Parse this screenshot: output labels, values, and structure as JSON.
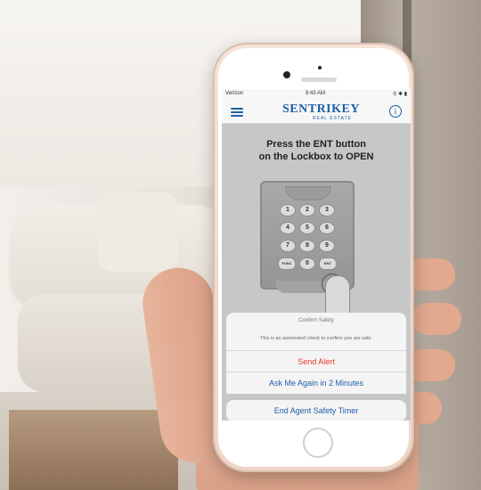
{
  "status": {
    "carrier": "Verizon",
    "time": "9:43 AM",
    "right": "⚲ ✱ ▮"
  },
  "header": {
    "brand": "SENTRIKEY",
    "brand_sub": "REAL ESTATE"
  },
  "instruction": "Press the ENT button\non the Lockbox to OPEN",
  "lockbox": {
    "keys": [
      "1",
      "2",
      "3",
      "4",
      "5",
      "6",
      "7",
      "8",
      "9",
      "FUNC",
      "0",
      "ENT"
    ]
  },
  "dialog": {
    "title": "Confirm Safety",
    "message": "This is an automated check to confirm you are safe.",
    "buttons": {
      "send_alert": "Send Alert",
      "ask_again": "Ask Me Again in 2 Minutes",
      "end_timer": "End Agent Safety Timer"
    }
  },
  "colors": {
    "brand_blue": "#1f5fa8",
    "alert_red": "#e53b2c"
  }
}
